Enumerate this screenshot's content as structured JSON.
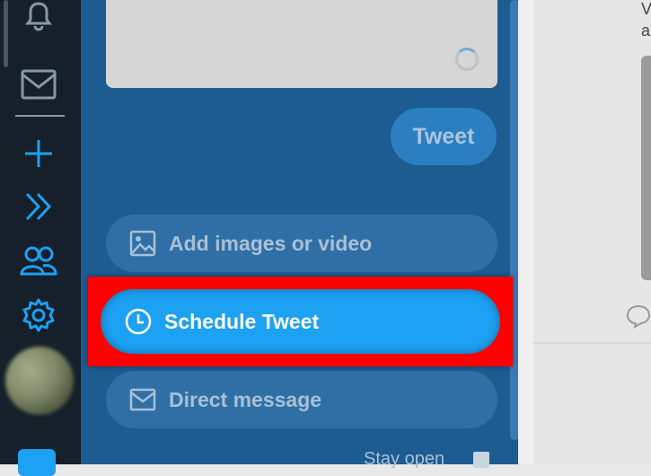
{
  "composer": {
    "tweet_label": "Tweet",
    "actions": [
      {
        "label": "Add images or video",
        "icon": "image-icon"
      },
      {
        "label": "Schedule Tweet",
        "icon": "clock-icon"
      },
      {
        "label": "Direct message",
        "icon": "mail-icon"
      }
    ],
    "stay_open_label": "Stay open"
  },
  "right_pane": {
    "text_1": "V",
    "text_2": "a"
  },
  "colors": {
    "sidebar_bg": "#15202b",
    "composer_bg": "#1c5c91",
    "accent": "#1da1f2",
    "highlight": "#ff0000"
  }
}
